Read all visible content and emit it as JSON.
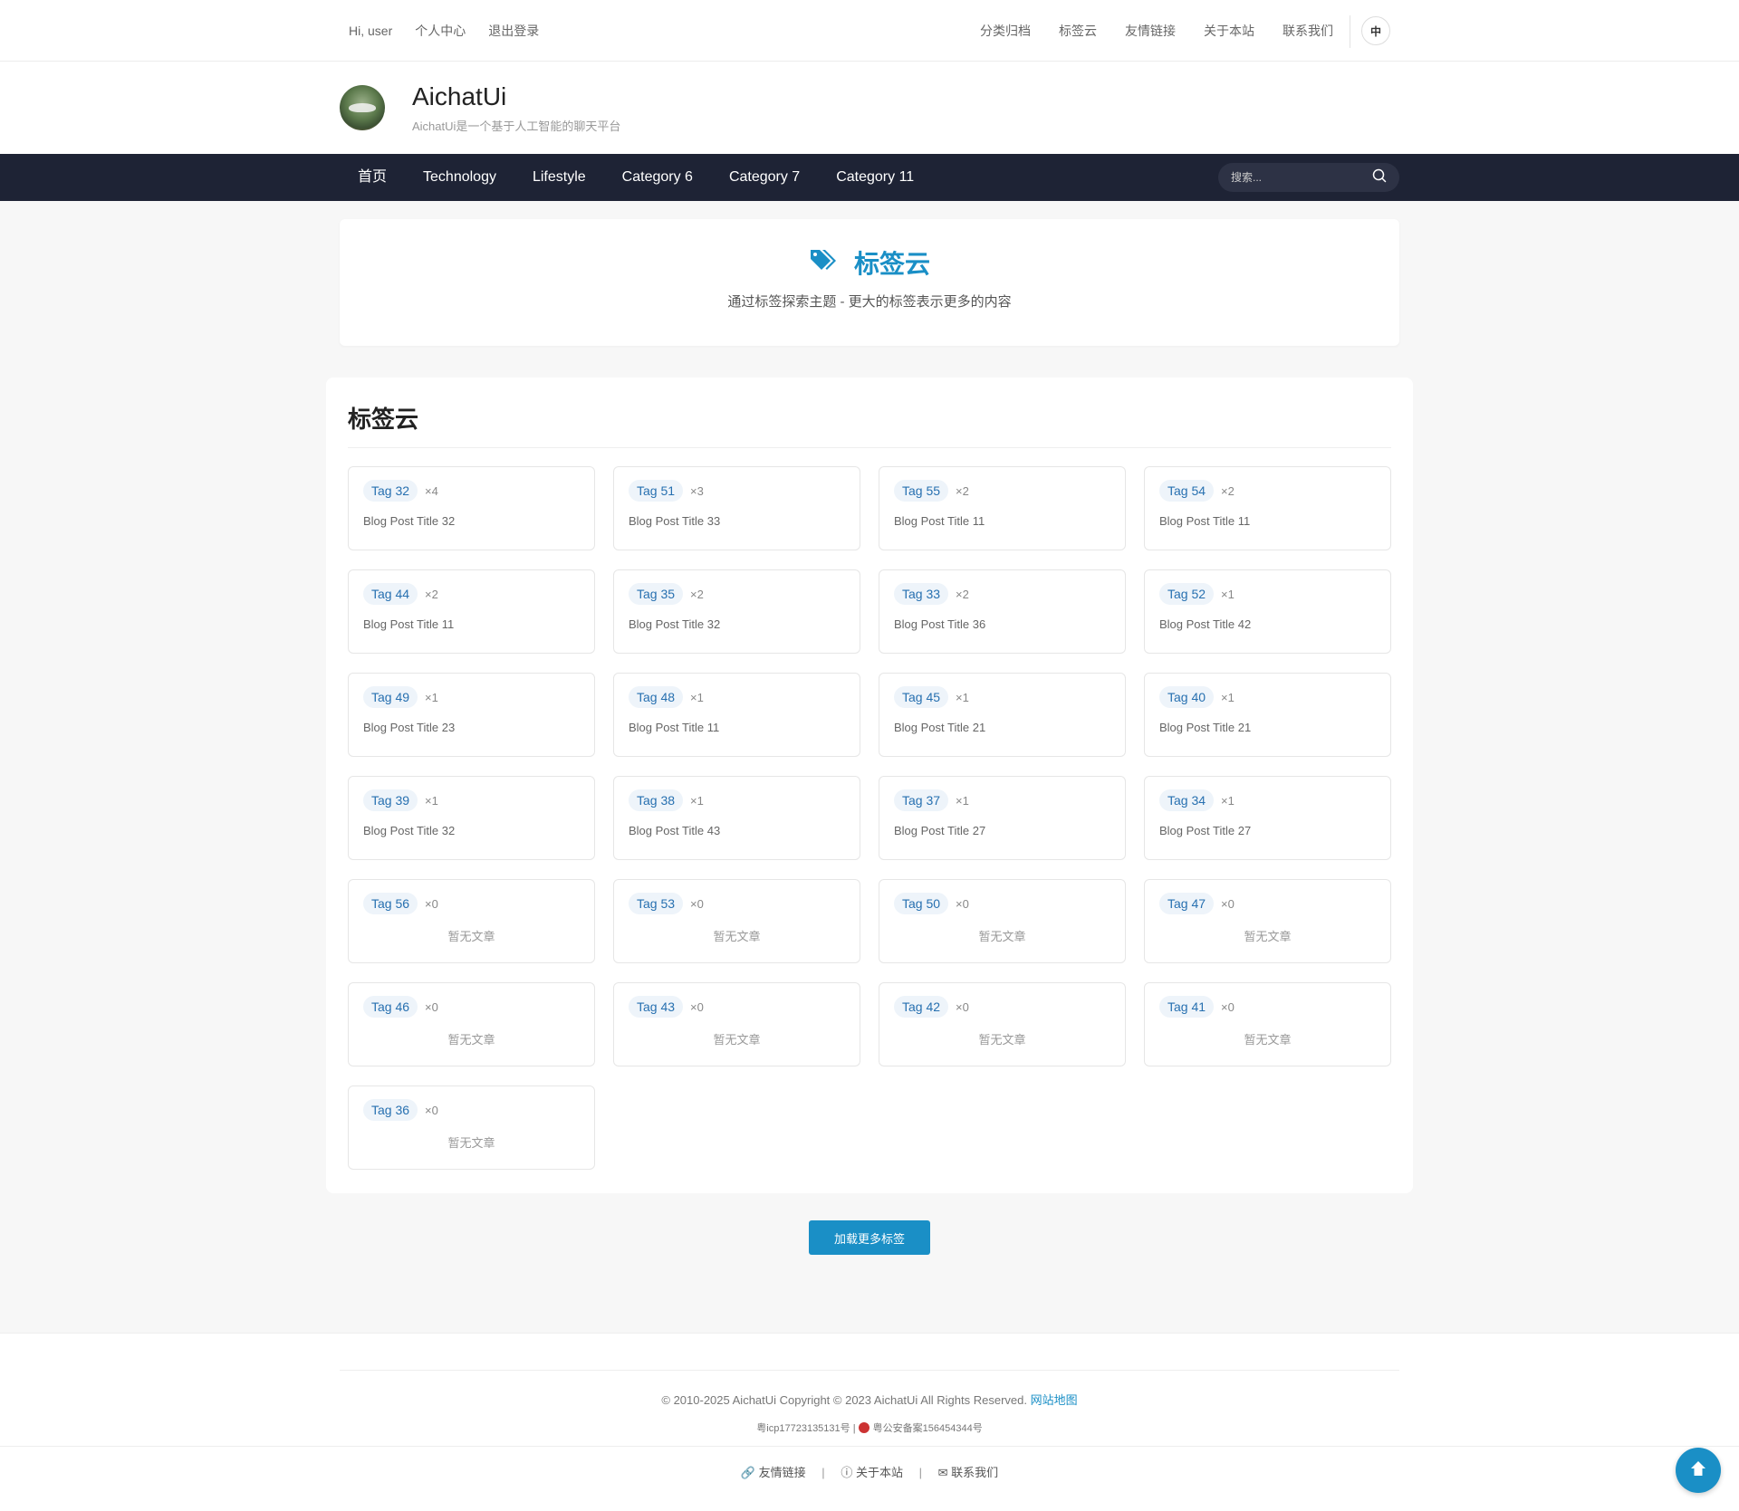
{
  "topbar": {
    "greeting": "Hi, user",
    "profile": "个人中心",
    "logout": "退出登录",
    "links": [
      "分类归档",
      "标签云",
      "友情链接",
      "关于本站",
      "联系我们"
    ],
    "lang": "中"
  },
  "header": {
    "title": "AichatUi",
    "subtitle": "AichatUi是一个基于人工智能的聊天平台"
  },
  "nav": {
    "items": [
      "首页",
      "Technology",
      "Lifestyle",
      "Category 6",
      "Category 7",
      "Category 11"
    ],
    "search_placeholder": "搜索..."
  },
  "hero": {
    "title": "标签云",
    "description": "通过标签探索主题 - 更大的标签表示更多的内容"
  },
  "cloud": {
    "heading": "标签云",
    "tags": [
      {
        "tag": "Tag 32",
        "count": "×4",
        "post": "Blog Post Title 32"
      },
      {
        "tag": "Tag 51",
        "count": "×3",
        "post": "Blog Post Title 33"
      },
      {
        "tag": "Tag 55",
        "count": "×2",
        "post": "Blog Post Title 11"
      },
      {
        "tag": "Tag 54",
        "count": "×2",
        "post": "Blog Post Title 11"
      },
      {
        "tag": "Tag 44",
        "count": "×2",
        "post": "Blog Post Title 11"
      },
      {
        "tag": "Tag 35",
        "count": "×2",
        "post": "Blog Post Title 32"
      },
      {
        "tag": "Tag 33",
        "count": "×2",
        "post": "Blog Post Title 36"
      },
      {
        "tag": "Tag 52",
        "count": "×1",
        "post": "Blog Post Title 42"
      },
      {
        "tag": "Tag 49",
        "count": "×1",
        "post": "Blog Post Title 23"
      },
      {
        "tag": "Tag 48",
        "count": "×1",
        "post": "Blog Post Title 11"
      },
      {
        "tag": "Tag 45",
        "count": "×1",
        "post": "Blog Post Title 21"
      },
      {
        "tag": "Tag 40",
        "count": "×1",
        "post": "Blog Post Title 21"
      },
      {
        "tag": "Tag 39",
        "count": "×1",
        "post": "Blog Post Title 32"
      },
      {
        "tag": "Tag 38",
        "count": "×1",
        "post": "Blog Post Title 43"
      },
      {
        "tag": "Tag 37",
        "count": "×1",
        "post": "Blog Post Title 27"
      },
      {
        "tag": "Tag 34",
        "count": "×1",
        "post": "Blog Post Title 27"
      },
      {
        "tag": "Tag 56",
        "count": "×0",
        "post": "暂无文章"
      },
      {
        "tag": "Tag 53",
        "count": "×0",
        "post": "暂无文章"
      },
      {
        "tag": "Tag 50",
        "count": "×0",
        "post": "暂无文章"
      },
      {
        "tag": "Tag 47",
        "count": "×0",
        "post": "暂无文章"
      },
      {
        "tag": "Tag 46",
        "count": "×0",
        "post": "暂无文章"
      },
      {
        "tag": "Tag 43",
        "count": "×0",
        "post": "暂无文章"
      },
      {
        "tag": "Tag 42",
        "count": "×0",
        "post": "暂无文章"
      },
      {
        "tag": "Tag 41",
        "count": "×0",
        "post": "暂无文章"
      },
      {
        "tag": "Tag 36",
        "count": "×0",
        "post": "暂无文章"
      }
    ],
    "load_more": "加载更多标签"
  },
  "footer": {
    "copyright": "© 2010-2025 AichatUi Copyright © 2023 AichatUi All Rights Reserved.",
    "sitemap": "网站地图",
    "icp": "粤icp17723135131号",
    "separator": "|",
    "police": "粤公安备案156454344号",
    "links": [
      "友情链接",
      "关于本站",
      "联系我们"
    ]
  },
  "colors": {
    "accent": "#1a8fc6",
    "nav_bg": "#1e2335",
    "tag_text": "#2770b0",
    "tag_bg": "#eef4fa"
  }
}
